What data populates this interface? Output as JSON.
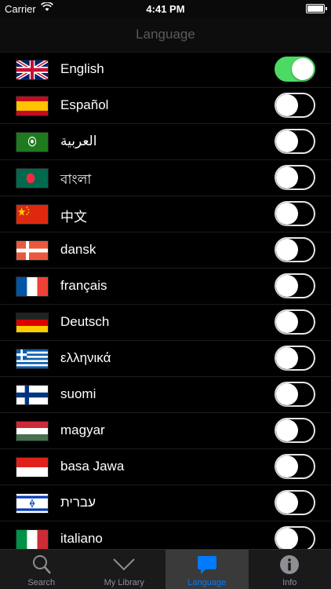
{
  "status_bar": {
    "carrier": "Carrier",
    "time": "4:41 PM"
  },
  "nav": {
    "title": "Language"
  },
  "languages": [
    {
      "label": "English",
      "flag": "uk-flag-icon",
      "enabled": true
    },
    {
      "label": "Español",
      "flag": "spain-flag-icon",
      "enabled": false
    },
    {
      "label": "العربية",
      "flag": "arab-league-flag-icon",
      "enabled": false
    },
    {
      "label": "বাংলা",
      "flag": "bangladesh-flag-icon",
      "enabled": false
    },
    {
      "label": "中文",
      "flag": "china-flag-icon",
      "enabled": false
    },
    {
      "label": "dansk",
      "flag": "denmark-flag-icon",
      "enabled": false
    },
    {
      "label": "français",
      "flag": "france-flag-icon",
      "enabled": false
    },
    {
      "label": "Deutsch",
      "flag": "germany-flag-icon",
      "enabled": false
    },
    {
      "label": "ελληνικά",
      "flag": "greece-flag-icon",
      "enabled": false
    },
    {
      "label": "suomi",
      "flag": "finland-flag-icon",
      "enabled": false
    },
    {
      "label": "magyar",
      "flag": "hungary-flag-icon",
      "enabled": false
    },
    {
      "label": "basa Jawa",
      "flag": "indonesia-flag-icon",
      "enabled": false
    },
    {
      "label": "עברית",
      "flag": "israel-flag-icon",
      "enabled": false
    },
    {
      "label": "italiano",
      "flag": "italy-flag-icon",
      "enabled": false
    }
  ],
  "tabs": [
    {
      "label": "Search",
      "icon": "search-icon",
      "active": false
    },
    {
      "label": "My Library",
      "icon": "chevron-down-icon",
      "active": false
    },
    {
      "label": "Language",
      "icon": "speech-bubble-icon",
      "active": true
    },
    {
      "label": "Info",
      "icon": "info-icon",
      "active": false
    }
  ],
  "colors": {
    "toggle_on": "#4cd964",
    "tab_active": "#007aff",
    "tab_inactive": "#8e8e93"
  }
}
